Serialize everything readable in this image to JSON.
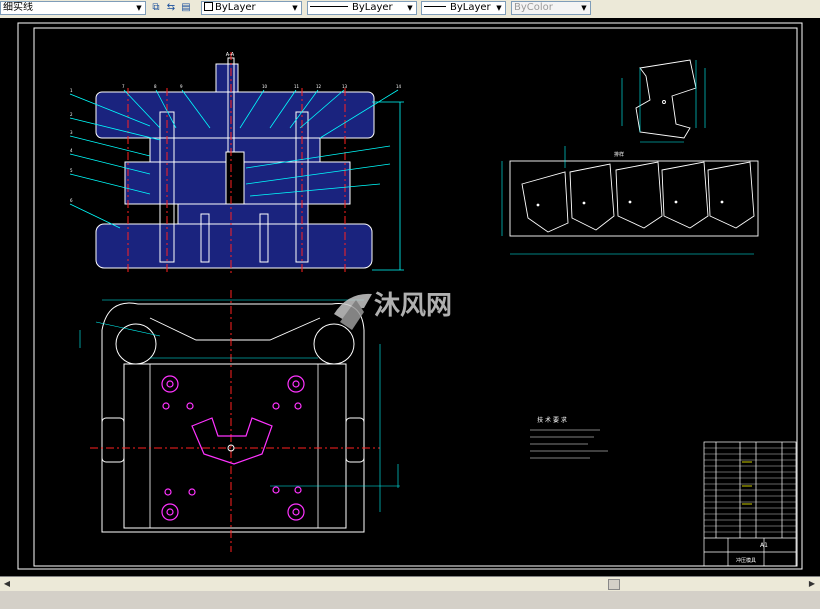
{
  "toolbar": {
    "linetype_name": "细实线",
    "color_control": "ByLayer",
    "linetype_control": "ByLayer",
    "lineweight_control": "ByLayer",
    "plotstyle_control": "ByColor"
  },
  "watermark": {
    "brand": "沐风网"
  },
  "drawing": {
    "section_label": "A-A",
    "layout_label": "排样",
    "tech_title": "技 术 要 求",
    "title_block_name": "冲压模具",
    "sheet_size": "A1",
    "colors": {
      "background": "#000000",
      "lines": "#ffffff",
      "dims": "#00ffff",
      "fill": "#1a237e",
      "center": "#ff2020",
      "holes": "#ff33ff"
    }
  }
}
